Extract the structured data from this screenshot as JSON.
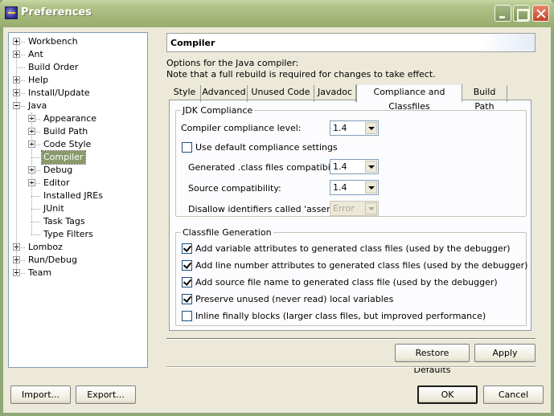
{
  "window": {
    "title": "Preferences",
    "controls": [
      "minimize",
      "maximize",
      "close"
    ]
  },
  "tree": {
    "items": [
      {
        "label": "Workbench",
        "level": 0,
        "expander": "plus"
      },
      {
        "label": "Ant",
        "level": 0,
        "expander": "plus"
      },
      {
        "label": "Build Order",
        "level": 0,
        "expander": "none"
      },
      {
        "label": "Help",
        "level": 0,
        "expander": "plus"
      },
      {
        "label": "Install/Update",
        "level": 0,
        "expander": "plus"
      },
      {
        "label": "Java",
        "level": 0,
        "expander": "minus"
      },
      {
        "label": "Appearance",
        "level": 1,
        "expander": "plus"
      },
      {
        "label": "Build Path",
        "level": 1,
        "expander": "plus"
      },
      {
        "label": "Code Style",
        "level": 1,
        "expander": "plus"
      },
      {
        "label": "Compiler",
        "level": 1,
        "expander": "none",
        "selected": true
      },
      {
        "label": "Debug",
        "level": 1,
        "expander": "plus"
      },
      {
        "label": "Editor",
        "level": 1,
        "expander": "plus"
      },
      {
        "label": "Installed JREs",
        "level": 1,
        "expander": "none"
      },
      {
        "label": "JUnit",
        "level": 1,
        "expander": "none"
      },
      {
        "label": "Task Tags",
        "level": 1,
        "expander": "none"
      },
      {
        "label": "Type Filters",
        "level": 1,
        "expander": "none"
      },
      {
        "label": "Lomboz",
        "level": 0,
        "expander": "plus"
      },
      {
        "label": "Run/Debug",
        "level": 0,
        "expander": "plus"
      },
      {
        "label": "Team",
        "level": 0,
        "expander": "plus"
      }
    ]
  },
  "page": {
    "title": "Compiler",
    "description_line1": "Options for the Java compiler:",
    "description_line2": "Note that a full rebuild is required for changes to take effect."
  },
  "tabs": [
    {
      "label": "Style"
    },
    {
      "label": "Advanced"
    },
    {
      "label": "Unused Code"
    },
    {
      "label": "Javadoc"
    },
    {
      "label": "Compliance and Classfiles",
      "active": true
    },
    {
      "label": "Build Path"
    }
  ],
  "jdk_compliance": {
    "title": "JDK Compliance",
    "compliance_level_label": "Compiler compliance level:",
    "compliance_level_value": "1.4",
    "use_default_label": "Use default compliance settings",
    "use_default_checked": false,
    "generated_label": "Generated .class files compatibility:",
    "generated_value": "1.4",
    "source_label": "Source compatibility:",
    "source_value": "1.4",
    "assert_label": "Disallow identifiers called 'assert':",
    "assert_value": "Error",
    "assert_disabled": true
  },
  "classfile_generation": {
    "title": "Classfile Generation",
    "options": [
      {
        "label": "Add variable attributes to generated class files (used by the debugger)",
        "checked": true
      },
      {
        "label": "Add line number attributes to generated class files (used by the debugger)",
        "checked": true
      },
      {
        "label": "Add source file name to generated class file (used by the debugger)",
        "checked": true
      },
      {
        "label": "Preserve unused (never read) local variables",
        "checked": true
      },
      {
        "label": "Inline finally blocks (larger class files, but improved performance)",
        "checked": false
      }
    ]
  },
  "buttons": {
    "restore_defaults": "Restore Defaults",
    "apply": "Apply",
    "import": "Import...",
    "export": "Export...",
    "ok": "OK",
    "cancel": "Cancel"
  }
}
